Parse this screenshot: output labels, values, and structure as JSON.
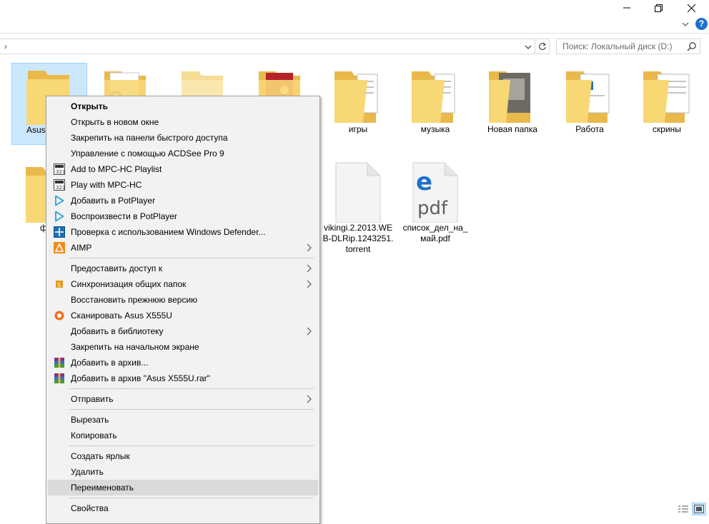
{
  "window": {
    "minimize_icon": "minimize-icon",
    "restore_icon": "restore-icon",
    "close_icon": "close-icon",
    "help_label": "?"
  },
  "address": {
    "chevron": "›",
    "path_text": ""
  },
  "search": {
    "placeholder": "Поиск: Локальный диск (D:)"
  },
  "files": [
    {
      "name": "Asus",
      "type": "folder",
      "selected": true
    },
    {
      "name": "",
      "type": "folder"
    },
    {
      "name": "",
      "type": "folder"
    },
    {
      "name": "",
      "type": "folder"
    },
    {
      "name": "игры",
      "type": "folder"
    },
    {
      "name": "музыка",
      "type": "folder"
    },
    {
      "name": "Новая папка",
      "type": "folder"
    },
    {
      "name": "Работа",
      "type": "folder"
    },
    {
      "name": "скрины",
      "type": "folder"
    },
    {
      "name": "ф",
      "type": "folder"
    },
    {
      "name_line1": "vikingi.2.2013.WE",
      "name_line2": "B-DLRip.1243251.",
      "name_line3": "torrent",
      "type": "torrent"
    },
    {
      "name_line1": "список_дел_на_",
      "name_line2": "май.pdf",
      "type": "pdf",
      "pdf_text": "pdf"
    }
  ],
  "context_menu": {
    "items": [
      {
        "label": "Открыть",
        "bold": true
      },
      {
        "label": "Открыть в новом окне"
      },
      {
        "label": "Закрепить на панели быстрого доступа"
      },
      {
        "label": "Управление с помощью ACDSee Pro 9"
      },
      {
        "label": "Add to MPC-HC Playlist",
        "icon": "mpc-hc-icon"
      },
      {
        "label": "Play with MPC-HC",
        "icon": "mpc-hc-icon"
      },
      {
        "label": "Добавить в PotPlayer",
        "icon": "potplayer-icon"
      },
      {
        "label": "Воспроизвести в PotPlayer",
        "icon": "potplayer-icon"
      },
      {
        "label": "Проверка с использованием Windows Defender...",
        "icon": "windows-defender-icon"
      },
      {
        "label": "AIMP",
        "icon": "aimp-icon",
        "submenu": true
      },
      {
        "label": "Предоставить доступ к",
        "submenu": true
      },
      {
        "label": "Синхронизация общих папок",
        "icon": "sync-icon",
        "submenu": true
      },
      {
        "label": "Восстановить прежнюю версию"
      },
      {
        "label": "Сканировать Asus X555U",
        "icon": "avast-icon"
      },
      {
        "label": "Добавить в библиотеку",
        "submenu": true
      },
      {
        "label": "Закрепить на начальном экране"
      },
      {
        "label": "Добавить в архив...",
        "icon": "winrar-icon"
      },
      {
        "label": "Добавить в архив \"Asus X555U.rar\"",
        "icon": "winrar-icon"
      },
      {
        "label": "Отправить",
        "submenu": true
      },
      {
        "label": "Вырезать"
      },
      {
        "label": "Копировать"
      },
      {
        "label": "Создать ярлык"
      },
      {
        "label": "Удалить"
      },
      {
        "label": "Переименовать",
        "highlighted": true
      },
      {
        "label": "Свойства"
      }
    ]
  },
  "colors": {
    "folder": "#f8d775",
    "folder_dark": "#e9b94b",
    "selection": "#cce8ff",
    "menu_bg": "#f2f2f2",
    "menu_hover": "#dadada",
    "accent_blue": "#1e73c8"
  }
}
